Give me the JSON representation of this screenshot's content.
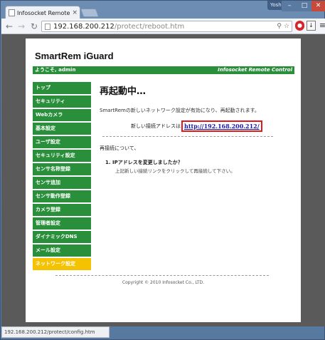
{
  "browser": {
    "tab_title": "Infosocket Remote Con",
    "tab_close": "×",
    "user_badge": "Yoshihide",
    "win_min": "–",
    "win_max": "□",
    "win_close": "✕",
    "nav_back": "←",
    "nav_forward": "→",
    "nav_reload": "↻",
    "url_host": "192.168.200.212",
    "url_path": "/protect/reboot.htm",
    "omni_search_icon": "⚲",
    "omni_star_icon": "☆",
    "ext_red_label": "●",
    "ext_download_label": "↓",
    "ext_menu_label": "≡",
    "status_url": "192.168.200.212/protect/config.htm"
  },
  "site": {
    "title": "SmartRem iGuard",
    "welcome": "ようこそ, admin",
    "brand": "Infosocket Remote Control"
  },
  "sidebar": {
    "items": [
      {
        "label": "トップ"
      },
      {
        "label": "セキュリティ"
      },
      {
        "label": "Webカメラ"
      },
      {
        "label": "基本設定"
      },
      {
        "label": "ユーザ設定"
      },
      {
        "label": "セキュリティ設定"
      },
      {
        "label": "センサ名称登録"
      },
      {
        "label": "センサ追加"
      },
      {
        "label": "センサ動作登録"
      },
      {
        "label": "カメラ登録"
      },
      {
        "label": "管理者設定"
      },
      {
        "label": "ダイナミックDNS"
      },
      {
        "label": "メール設定"
      },
      {
        "label": "ネットワーク設定"
      }
    ],
    "active_index": 13
  },
  "main": {
    "heading": "再起動中…",
    "message": "SmartRemの新しいネットワーク設定が有効になり、再起動されます。",
    "new_address_label": "新しい接続アドレスは",
    "new_address_link": "http://192.168.200.212/",
    "reconnect_heading": "再接続について、",
    "question": "1. IPアドレスを変更しましたか？",
    "question_desc": "上記新しい接続リンクをクリックして再接続して下さい。"
  },
  "footer": {
    "copyright": "Copyright © 2010 Infosocket Co., LTD."
  }
}
